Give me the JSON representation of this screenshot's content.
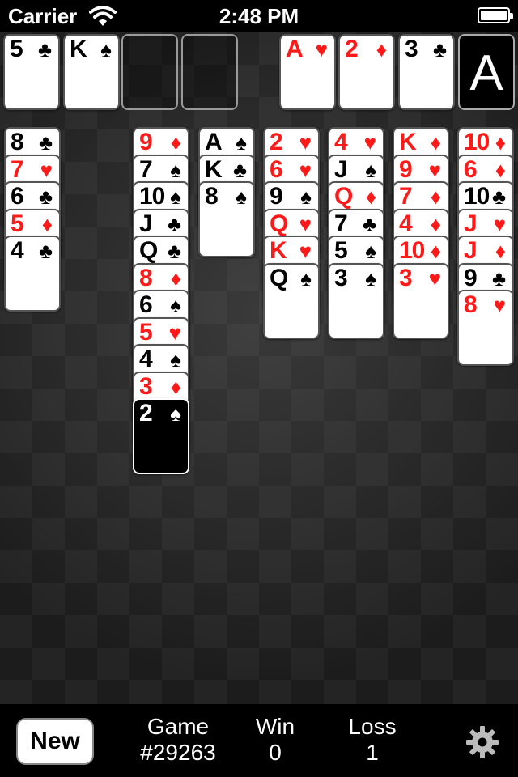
{
  "status_bar": {
    "carrier": "Carrier",
    "time": "2:48 PM"
  },
  "colors": {
    "red": "#ff1a1a",
    "black": "#000000",
    "felt": "#1f1f1f"
  },
  "free_cells": [
    {
      "rank": "5",
      "suit": "♣",
      "color": "black"
    },
    {
      "rank": "K",
      "suit": "♠",
      "color": "black"
    },
    null,
    null
  ],
  "foundations": [
    {
      "rank": "A",
      "suit": "♥",
      "color": "red"
    },
    {
      "rank": "2",
      "suit": "♦",
      "color": "red"
    },
    {
      "rank": "3",
      "suit": "♣",
      "color": "black"
    },
    {
      "empty_label": "A"
    }
  ],
  "tableau": [
    [
      {
        "rank": "8",
        "suit": "♣",
        "color": "black"
      },
      {
        "rank": "7",
        "suit": "♥",
        "color": "red"
      },
      {
        "rank": "6",
        "suit": "♣",
        "color": "black"
      },
      {
        "rank": "5",
        "suit": "♦",
        "color": "red"
      },
      {
        "rank": "4",
        "suit": "♣",
        "color": "black"
      }
    ],
    [],
    [
      {
        "rank": "9",
        "suit": "♦",
        "color": "red"
      },
      {
        "rank": "7",
        "suit": "♠",
        "color": "black"
      },
      {
        "rank": "10",
        "suit": "♠",
        "color": "black"
      },
      {
        "rank": "J",
        "suit": "♣",
        "color": "black"
      },
      {
        "rank": "Q",
        "suit": "♣",
        "color": "black"
      },
      {
        "rank": "8",
        "suit": "♦",
        "color": "red"
      },
      {
        "rank": "6",
        "suit": "♠",
        "color": "black"
      },
      {
        "rank": "5",
        "suit": "♥",
        "color": "red"
      },
      {
        "rank": "4",
        "suit": "♠",
        "color": "black"
      },
      {
        "rank": "3",
        "suit": "♦",
        "color": "red"
      },
      {
        "rank": "2",
        "suit": "♠",
        "color": "black",
        "selected": true
      }
    ],
    [
      {
        "rank": "A",
        "suit": "♠",
        "color": "black"
      },
      {
        "rank": "K",
        "suit": "♣",
        "color": "black"
      },
      {
        "rank": "8",
        "suit": "♠",
        "color": "black"
      }
    ],
    [
      {
        "rank": "2",
        "suit": "♥",
        "color": "red"
      },
      {
        "rank": "6",
        "suit": "♥",
        "color": "red"
      },
      {
        "rank": "9",
        "suit": "♠",
        "color": "black"
      },
      {
        "rank": "Q",
        "suit": "♥",
        "color": "red"
      },
      {
        "rank": "K",
        "suit": "♥",
        "color": "red"
      },
      {
        "rank": "Q",
        "suit": "♠",
        "color": "black"
      }
    ],
    [
      {
        "rank": "4",
        "suit": "♥",
        "color": "red"
      },
      {
        "rank": "J",
        "suit": "♠",
        "color": "black"
      },
      {
        "rank": "Q",
        "suit": "♦",
        "color": "red"
      },
      {
        "rank": "7",
        "suit": "♣",
        "color": "black"
      },
      {
        "rank": "5",
        "suit": "♠",
        "color": "black"
      },
      {
        "rank": "3",
        "suit": "♠",
        "color": "black"
      }
    ],
    [
      {
        "rank": "K",
        "suit": "♦",
        "color": "red"
      },
      {
        "rank": "9",
        "suit": "♥",
        "color": "red"
      },
      {
        "rank": "7",
        "suit": "♦",
        "color": "red"
      },
      {
        "rank": "4",
        "suit": "♦",
        "color": "red"
      },
      {
        "rank": "10",
        "suit": "♦",
        "color": "red"
      },
      {
        "rank": "3",
        "suit": "♥",
        "color": "red"
      }
    ],
    [
      {
        "rank": "10",
        "suit": "♦",
        "color": "red"
      },
      {
        "rank": "6",
        "suit": "♦",
        "color": "red"
      },
      {
        "rank": "10",
        "suit": "♣",
        "color": "black"
      },
      {
        "rank": "J",
        "suit": "♥",
        "color": "red"
      },
      {
        "rank": "J",
        "suit": "♦",
        "color": "red"
      },
      {
        "rank": "9",
        "suit": "♣",
        "color": "black"
      },
      {
        "rank": "8",
        "suit": "♥",
        "color": "red"
      }
    ]
  ],
  "bottom_bar": {
    "new_label": "New",
    "game_label": "Game",
    "game_value": "#29263",
    "win_label": "Win",
    "win_value": "0",
    "loss_label": "Loss",
    "loss_value": "1",
    "settings_icon": "gear-icon"
  }
}
